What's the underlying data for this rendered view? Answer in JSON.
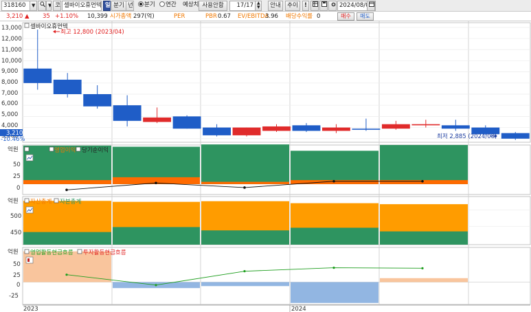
{
  "toolbar": {
    "code": "318160",
    "search_icon": "magnifier-icon",
    "market_tag": "코",
    "stock_name": "셀바이오휴먼텍",
    "badge": "일",
    "period_type": "분기",
    "unit_year": "년",
    "radio_quarter": "분기",
    "radio_annual": "연간",
    "estimate_label": "예상치",
    "estimate_value": "사용안함",
    "count": "17/17",
    "guide_label": "안내",
    "add_label": "추이",
    "alert_label": "!",
    "date": "2024/08/01"
  },
  "infobar": {
    "price": "3,210",
    "change": "35",
    "change_pct": "+1.10%",
    "volume": "10,399",
    "marketcap_label": "시가총액",
    "marketcap_value": "297(억)",
    "per_label": "PER",
    "pbr_label": "PBR",
    "pbr_value": "0.67",
    "ev_label": "EV/EBITDA",
    "ev_value": "3.96",
    "div_label": "배당수익률",
    "div_value": "0",
    "buy_label": "매수",
    "sell_label": "매도"
  },
  "colors": {
    "up": "#e02b2b",
    "down": "#1f5dc7",
    "revenue": "#2e9460",
    "op_profit": "#ff6a00",
    "assets": "#ff9c00",
    "equity": "#2e9460",
    "cf_op": "#1e9e1e",
    "cf_inv_pos": "#f9c59d",
    "cf_inv_neg": "#92b6e2"
  },
  "chart_data": [
    {
      "type": "candlestick",
      "title": "셀바이오휴먼텍",
      "y_ticks": [
        "13,000",
        "12,000",
        "11,000",
        "10,000",
        "9,000",
        "8,000",
        "7,000",
        "6,000",
        "5,000",
        "4,000",
        "3,000"
      ],
      "ylim": [
        2800,
        13300
      ],
      "current_price_label": "3,210",
      "current_change_label": "-10.46%",
      "high_annotation": "최고 12,800 (2023/04)",
      "low_annotation": "최저 2,885 (2024/08)",
      "candles": [
        {
          "o": 9300,
          "h": 12800,
          "l": 7400,
          "c": 8000
        },
        {
          "o": 8300,
          "h": 8900,
          "l": 6700,
          "c": 7000
        },
        {
          "o": 7000,
          "h": 7800,
          "l": 5700,
          "c": 5900
        },
        {
          "o": 6000,
          "h": 6900,
          "l": 4100,
          "c": 4600
        },
        {
          "o": 4500,
          "h": 5800,
          "l": 4400,
          "c": 4900
        },
        {
          "o": 5000,
          "h": 5100,
          "l": 3900,
          "c": 3900
        },
        {
          "o": 4000,
          "h": 4300,
          "l": 3200,
          "c": 3300
        },
        {
          "o": 3300,
          "h": 4000,
          "l": 3200,
          "c": 4000
        },
        {
          "o": 3700,
          "h": 4300,
          "l": 3600,
          "c": 4100
        },
        {
          "o": 4200,
          "h": 4400,
          "l": 3600,
          "c": 3700
        },
        {
          "o": 3700,
          "h": 4300,
          "l": 3500,
          "c": 4000
        },
        {
          "o": 3900,
          "h": 4800,
          "l": 3700,
          "c": 3800
        },
        {
          "o": 3900,
          "h": 4600,
          "l": 3800,
          "c": 4300
        },
        {
          "o": 4200,
          "h": 4700,
          "l": 4000,
          "c": 4300
        },
        {
          "o": 4200,
          "h": 4700,
          "l": 3700,
          "c": 3900
        },
        {
          "o": 4000,
          "h": 4200,
          "l": 3300,
          "c": 3400
        },
        {
          "o": 3500,
          "h": 3600,
          "l": 2885,
          "c": 3000
        }
      ]
    },
    {
      "type": "bar",
      "unit": "억원",
      "legend": [
        "매출액",
        "영업이익",
        "당기순이익"
      ],
      "y_ticks": [
        "50",
        "25",
        "0"
      ],
      "ylim": [
        -18,
        68
      ],
      "revenue": [
        67,
        65,
        69,
        58,
        68
      ],
      "op_profit": [
        7,
        12,
        4,
        7,
        7
      ],
      "net_income": [
        -10,
        2,
        -6,
        5,
        5
      ]
    },
    {
      "type": "bar",
      "unit": "억원",
      "legend": [
        "자산총계",
        "자본총계"
      ],
      "y_ticks": [
        "500",
        "450"
      ],
      "ylim": [
        395,
        540
      ],
      "assets": [
        527,
        524,
        526,
        520,
        517
      ],
      "equity": [
        433,
        448,
        438,
        446,
        435
      ]
    },
    {
      "type": "bar",
      "unit": "억원",
      "legend": [
        "영업활동현금흐름",
        "투자활동현금흐름"
      ],
      "y_ticks": [
        "50",
        "25",
        "0",
        "-25"
      ],
      "ylim": [
        -45,
        70
      ],
      "investing_cf": [
        62,
        -12,
        -8,
        -42,
        8
      ],
      "operating_cf": [
        15,
        -6,
        22,
        29,
        28
      ]
    }
  ],
  "x_labels": [
    "2023",
    "2024"
  ]
}
